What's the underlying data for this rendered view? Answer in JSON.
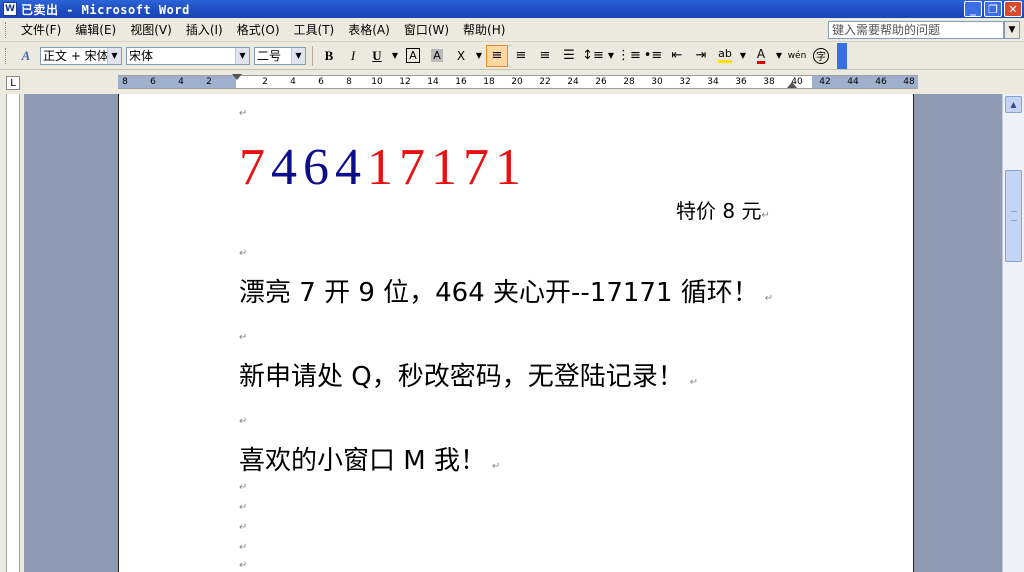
{
  "window": {
    "title": "已卖出 - Microsoft Word",
    "app_icon_glyph": "W"
  },
  "menu": {
    "items": [
      "文件(F)",
      "编辑(E)",
      "视图(V)",
      "插入(I)",
      "格式(O)",
      "工具(T)",
      "表格(A)",
      "窗口(W)",
      "帮助(H)"
    ],
    "help_placeholder": "键入需要帮助的问题"
  },
  "toolbar": {
    "style": "正文 + 宋体",
    "font": "宋体",
    "size": "二号"
  },
  "ruler": {
    "numbers": [
      "8",
      "6",
      "4",
      "2",
      "2",
      "4",
      "6",
      "8",
      "10",
      "12",
      "14",
      "16",
      "18",
      "20",
      "22",
      "24",
      "26",
      "28",
      "30",
      "32",
      "34",
      "36",
      "38",
      "40",
      "42",
      "44",
      "46",
      "48"
    ]
  },
  "document": {
    "big_number": {
      "part_blue": [
        "7",
        "4",
        "6",
        "4"
      ],
      "part_red": [
        "1",
        "7",
        "1",
        "7",
        "1"
      ],
      "colors": {
        "blue": "#0d0d8c",
        "red": "#e81010",
        "first": "#e81010"
      }
    },
    "price": "特价 8 元",
    "line1": "漂亮 7 开 9 位，464 夹心开--17171 循环！",
    "line2": "新申请处 Q，秒改密码，无登陆记录！",
    "line3": "喜欢的小窗口 M 我！",
    "para_mark": "↵"
  }
}
